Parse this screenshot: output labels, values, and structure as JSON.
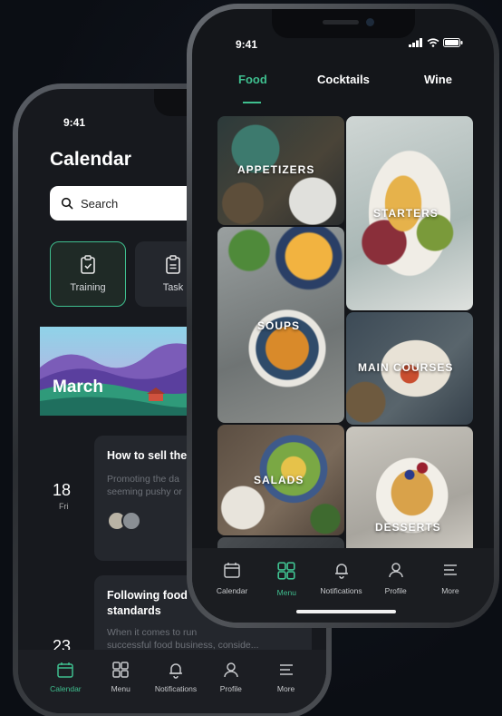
{
  "back_phone": {
    "time": "9:41",
    "title": "Calendar",
    "search_label": "Search",
    "categories": [
      {
        "label": "Training",
        "icon": "clipboard-check-icon",
        "active": true
      },
      {
        "label": "Task",
        "icon": "clipboard-list-icon",
        "active": false
      }
    ],
    "banner_label": "March",
    "events": [
      {
        "date": "18",
        "day": "Fri",
        "title": "How to sell the",
        "desc": "Promoting the da\nseeming pushy or"
      },
      {
        "date": "23",
        "day": "",
        "title": "Following food\nstandards",
        "desc": "When it comes to run\nsuccessful food business, conside..."
      }
    ],
    "tabbar": [
      {
        "label": "Calendar",
        "icon": "calendar-icon",
        "active": true
      },
      {
        "label": "Menu",
        "icon": "grid-icon",
        "active": false
      },
      {
        "label": "Notifications",
        "icon": "bell-icon",
        "active": false
      },
      {
        "label": "Profile",
        "icon": "user-icon",
        "active": false
      },
      {
        "label": "More",
        "icon": "menu-icon",
        "active": false
      }
    ]
  },
  "front_phone": {
    "time": "9:41",
    "tabs": [
      {
        "label": "Food",
        "active": true
      },
      {
        "label": "Cocktails",
        "active": false
      },
      {
        "label": "Wine",
        "active": false
      }
    ],
    "tiles": [
      {
        "label": "APPETIZERS"
      },
      {
        "label": "STARTERS"
      },
      {
        "label": "SOUPS"
      },
      {
        "label": "MAIN COURSES"
      },
      {
        "label": "SALADS"
      },
      {
        "label": "DESSERTS"
      }
    ],
    "tabbar": [
      {
        "label": "Calendar",
        "icon": "calendar-icon",
        "active": false
      },
      {
        "label": "Menu",
        "icon": "grid-icon",
        "active": true
      },
      {
        "label": "Notifications",
        "icon": "bell-icon",
        "active": false
      },
      {
        "label": "Profile",
        "icon": "user-icon",
        "active": false
      },
      {
        "label": "More",
        "icon": "menu-icon",
        "active": false
      }
    ]
  },
  "colors": {
    "accent": "#3fbf8f",
    "background": "#0b0e14",
    "screen": "#14161a",
    "card": "#24272d"
  }
}
